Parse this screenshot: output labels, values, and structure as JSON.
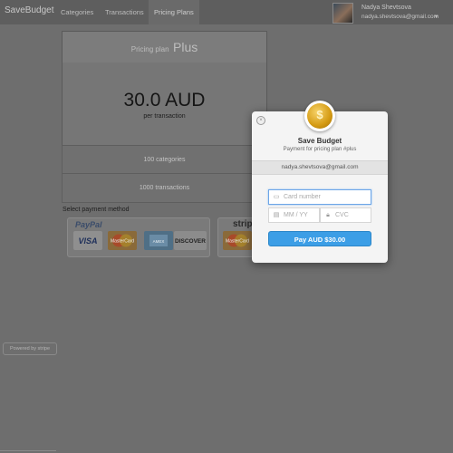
{
  "navbar": {
    "brand": "SaveBudget",
    "links": [
      "Categories",
      "Transactions",
      "Pricing Plans"
    ],
    "active_link": "Pricing Plans",
    "user_name": "Nadya Shevtsova",
    "user_email": "nadya.shevtsova@gmail.com",
    "caret": "▾"
  },
  "plan": {
    "title_prefix": "Pricing plan",
    "title_name": "Plus",
    "price": "30.0 AUD",
    "price_sub": "per transaction",
    "features": [
      "100 categories",
      "1000 transactions"
    ]
  },
  "payment": {
    "label": "Select payment method",
    "paypal_label": "PayPal",
    "cards": [
      "VISA",
      "MasterCard",
      "AMEX",
      "DISCOVER"
    ],
    "stripe_label": "stripe",
    "stripe_card": "MasterCard",
    "powered_by": "Powered by stripe"
  },
  "checkout": {
    "logo_icon": "coin-icon",
    "title": "Save Budget",
    "subtitle": "Payment for pricing plan #plus",
    "email": "nadya.shevtsova@gmail.com",
    "card_placeholder": "Card number",
    "expiry_placeholder": "MM / YY",
    "cvc_placeholder": "CVC",
    "pay_button": "Pay AUD $30.00",
    "close_symbol": "×"
  },
  "colors": {
    "overlay": "#6e6e6e",
    "pay_button": "#3c9ee6",
    "focus_border": "#6da6e8"
  }
}
